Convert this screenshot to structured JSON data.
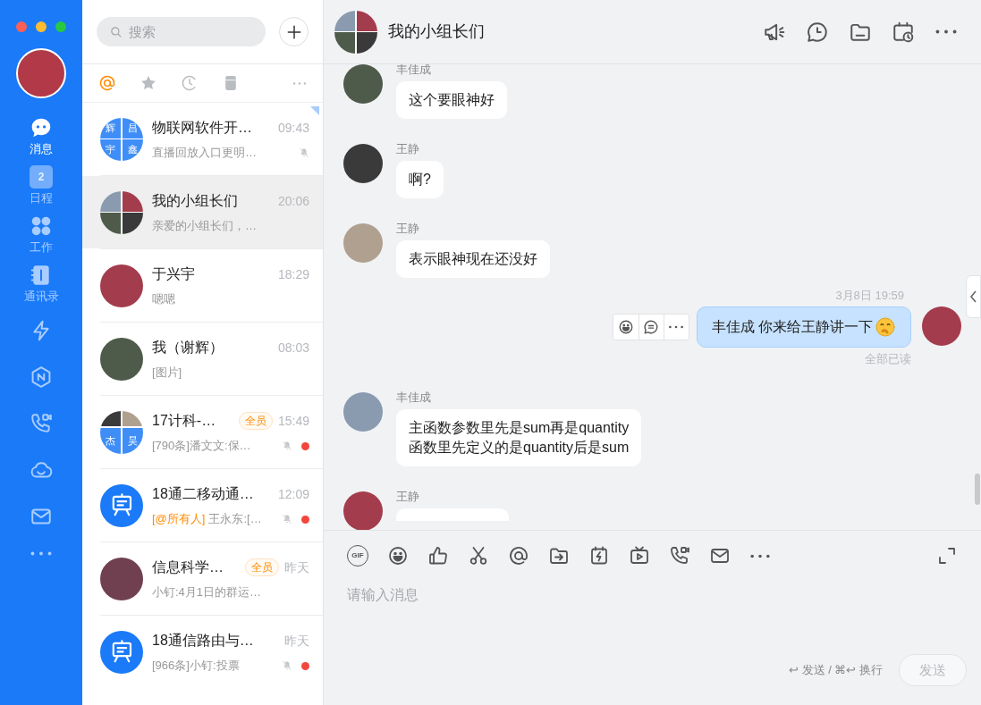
{
  "nav": {
    "items": [
      {
        "kind": "chat",
        "label": "消息",
        "selected": true
      },
      {
        "kind": "calendar",
        "label": "日程",
        "badge": "2",
        "selected": false
      },
      {
        "kind": "apps",
        "label": "工作",
        "selected": false
      },
      {
        "kind": "contacts",
        "label": "通讯录",
        "selected": false
      },
      {
        "kind": "lightning",
        "selected": false
      },
      {
        "kind": "hexagon",
        "selected": false
      },
      {
        "kind": "phone",
        "selected": false
      },
      {
        "kind": "cloud",
        "selected": false
      },
      {
        "kind": "mail",
        "selected": false
      },
      {
        "kind": "more",
        "selected": false
      }
    ]
  },
  "search": {
    "placeholder": "搜索"
  },
  "filters": [
    {
      "kind": "at",
      "selected": true
    },
    {
      "kind": "star",
      "selected": false
    },
    {
      "kind": "recent",
      "selected": false
    },
    {
      "kind": "archive",
      "selected": false
    },
    {
      "kind": "more",
      "selected": false
    }
  ],
  "conversations": [
    {
      "name": "物联网软件开…",
      "time": "09:43",
      "preview": "直播回放入口更明…",
      "muted": true,
      "unread": false,
      "pinned": true,
      "selected": false,
      "avatar": {
        "kind": "grid",
        "cells": [
          "辉",
          "昌",
          "宇",
          "鑫"
        ]
      }
    },
    {
      "name": "我的小组长们",
      "time": "20:06",
      "preview": "亲爱的小组长们，…",
      "muted": false,
      "unread": false,
      "pinned": false,
      "selected": true,
      "avatar": {
        "kind": "grid",
        "cells": [
          null,
          null,
          null,
          null
        ]
      }
    },
    {
      "name": "于兴宇",
      "time": "18:29",
      "preview": "嗯嗯",
      "muted": false,
      "unread": false,
      "pinned": false,
      "selected": false,
      "avatar": {
        "kind": "photo"
      }
    },
    {
      "name": "我（谢辉）",
      "time": "08:03",
      "preview": "[图片]",
      "muted": false,
      "unread": false,
      "pinned": false,
      "selected": false,
      "avatar": {
        "kind": "photo"
      }
    },
    {
      "name": "17计科-…",
      "tag": "全员",
      "time": "15:49",
      "preview": "[790条]潘文文:保…",
      "muted": true,
      "unread": true,
      "pinned": false,
      "selected": false,
      "avatar": {
        "kind": "grid",
        "cells": [
          null,
          null,
          "杰",
          "昊"
        ]
      }
    },
    {
      "name": "18通二移动通…",
      "time": "12:09",
      "mention": "[@所有人]",
      "preview": "王永东:[…",
      "muted": true,
      "unread": true,
      "pinned": false,
      "selected": false,
      "avatar": {
        "kind": "board"
      }
    },
    {
      "name": "信息科学…",
      "tag": "全员",
      "time": "昨天",
      "preview": "小钉:4月1日的群运…",
      "muted": false,
      "unread": false,
      "pinned": false,
      "selected": false,
      "avatar": {
        "kind": "photo"
      }
    },
    {
      "name": "18通信路由与…",
      "time": "昨天",
      "preview": "[966条]小钉:投票",
      "muted": true,
      "unread": true,
      "pinned": false,
      "selected": false,
      "avatar": {
        "kind": "board"
      }
    }
  ],
  "chat": {
    "title": "我的小组长们",
    "messages": [
      {
        "kind": "incoming",
        "sender": "丰佳成",
        "text": "这个要眼神好"
      },
      {
        "kind": "incoming",
        "sender": "王静",
        "text": "啊?"
      },
      {
        "kind": "incoming",
        "sender": "王静",
        "text": "表示眼神现在还没好"
      },
      {
        "kind": "time",
        "text": "3月8日 19:59"
      },
      {
        "kind": "outgoing",
        "text": "丰佳成 你来给王静讲一下",
        "emoji": true,
        "read_status": "全部已读",
        "hover_actions": true
      },
      {
        "kind": "incoming",
        "sender": "丰佳成",
        "text": "主函数参数里先是sum再是quantity\n函数里先定义的是quantity后是sum"
      },
      {
        "kind": "incoming",
        "sender": "王静"
      }
    ]
  },
  "composer": {
    "tools": [
      {
        "kind": "gif",
        "label": "GIF"
      },
      {
        "kind": "emoji"
      },
      {
        "kind": "like"
      },
      {
        "kind": "screenshot"
      },
      {
        "kind": "at"
      },
      {
        "kind": "file"
      },
      {
        "kind": "ding"
      },
      {
        "kind": "live"
      },
      {
        "kind": "call"
      },
      {
        "kind": "mail"
      },
      {
        "kind": "more"
      }
    ],
    "placeholder": "请输入消息",
    "hint": "↩ 发送 / ⌘↩ 换行",
    "send": {
      "label": "发送",
      "disabled": true
    }
  }
}
